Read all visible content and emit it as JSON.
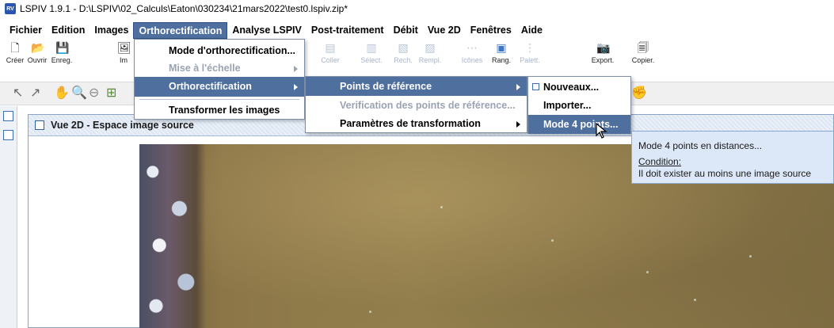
{
  "window": {
    "app_icon_label": "RV",
    "title": "LSPIV 1.9.1 - D:\\LSPIV\\02_Calculs\\Eaton\\030234\\21mars2022\\test0.lspiv.zip*"
  },
  "menubar": {
    "items": [
      "Fichier",
      "Edition",
      "Images",
      "Orthorectification",
      "Analyse LSPIV",
      "Post-traitement",
      "Débit",
      "Vue 2D",
      "Fenêtres",
      "Aide"
    ],
    "active": "Orthorectification"
  },
  "toolbar": {
    "buttons": [
      {
        "label": "Créer",
        "icon": "new-file-icon",
        "enabled": true
      },
      {
        "label": "Ouvrir",
        "icon": "open-folder-icon",
        "enabled": true
      },
      {
        "label": "Enreg.",
        "icon": "save-icon",
        "enabled": true
      },
      {
        "label": "Im",
        "icon": "image-icon",
        "enabled": true
      },
      {
        "label": "Coller",
        "icon": "paste-icon",
        "enabled": false
      },
      {
        "label": "Sélect.",
        "icon": "select-icon",
        "enabled": false
      },
      {
        "label": "Rech.",
        "icon": "search-icon",
        "enabled": false
      },
      {
        "label": "Rempl.",
        "icon": "replace-icon",
        "enabled": false
      },
      {
        "label": "Icônes",
        "icon": "icons-icon",
        "enabled": false
      },
      {
        "label": "Rang.",
        "icon": "arrange-icon",
        "enabled": true
      },
      {
        "label": "Palett.",
        "icon": "palette-icon",
        "enabled": false
      },
      {
        "label": "Export.",
        "icon": "camera-icon",
        "enabled": true
      },
      {
        "label": "Copier.",
        "icon": "copy-image-icon",
        "enabled": true
      }
    ]
  },
  "menu_ortho": {
    "items": [
      {
        "label": "Mode d'orthorectification...",
        "enabled": true,
        "submenu": false
      },
      {
        "label": "Mise à l'échelle",
        "enabled": false,
        "submenu": true
      },
      {
        "label": "Orthorectification",
        "enabled": true,
        "submenu": true,
        "highlighted": true
      },
      {
        "label": "Transformer les images",
        "enabled": true,
        "submenu": false
      }
    ]
  },
  "menu_ortho_sub": {
    "items": [
      {
        "label": "Points de référence",
        "enabled": true,
        "submenu": true,
        "highlighted": true
      },
      {
        "label": "Verification des points de référence...",
        "enabled": false,
        "submenu": false
      },
      {
        "label": "Paramètres de transformation",
        "enabled": true,
        "submenu": true
      }
    ]
  },
  "menu_points": {
    "items": [
      {
        "label": "Nouveaux...",
        "enabled": true,
        "checkbox": true
      },
      {
        "label": "Importer...",
        "enabled": true
      },
      {
        "label": "Mode 4 points...",
        "enabled": true,
        "highlighted": true
      }
    ]
  },
  "tooltip": {
    "line1": "Mode 4 points en distances...",
    "condition_label": "Condition:",
    "condition_text": "Il doit exister au moins une image source"
  },
  "subwindow": {
    "title": "Vue 2D - Espace image source"
  }
}
